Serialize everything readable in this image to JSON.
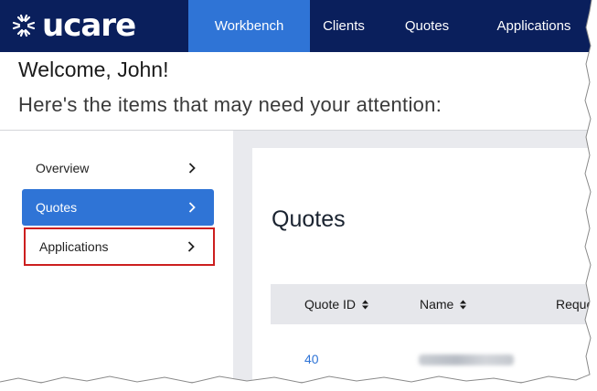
{
  "brand": {
    "logo_text": "ucare"
  },
  "colors": {
    "nav_bg": "#0a1f5c",
    "accent": "#2f74d6",
    "highlight_outline": "#cc1f1f",
    "content_bg": "#e9eaee"
  },
  "nav": {
    "tabs": [
      {
        "label": "Workbench",
        "active": true
      },
      {
        "label": "Clients",
        "active": false
      },
      {
        "label": "Quotes",
        "active": false
      },
      {
        "label": "Applications",
        "active": false
      }
    ]
  },
  "welcome": {
    "title": "Welcome, John!",
    "subtitle": "Here's the items that may need your attention:"
  },
  "sidebar": {
    "items": [
      {
        "label": "Overview",
        "icon": "chevron-right-icon",
        "active": false
      },
      {
        "label": "Quotes",
        "icon": "chevron-right-icon",
        "active": true
      },
      {
        "label": "Applications",
        "icon": "chevron-right-icon",
        "active": false,
        "highlighted": true
      }
    ]
  },
  "main": {
    "title": "Quotes",
    "table": {
      "columns": [
        {
          "label": "Quote ID",
          "sort_icon": "sort-icon"
        },
        {
          "label": "Name",
          "sort_icon": "sort-icon"
        },
        {
          "label": "Reque"
        }
      ],
      "rows": [
        {
          "quote_id": "40",
          "name_redacted": true
        }
      ]
    }
  }
}
